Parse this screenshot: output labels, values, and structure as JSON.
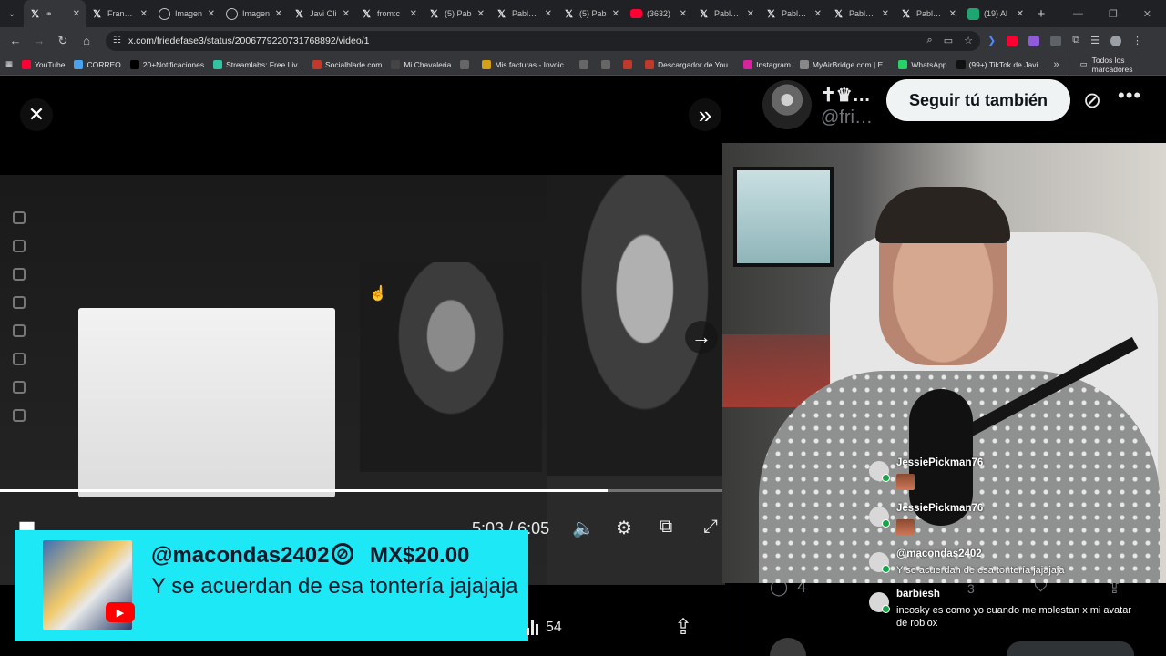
{
  "browser": {
    "tabs": [
      {
        "label": "",
        "icon": "x-icon",
        "active": true
      },
      {
        "label": "Frank C",
        "icon": "x-icon"
      },
      {
        "label": "Imagen",
        "icon": "globe-icon"
      },
      {
        "label": "Imagen",
        "icon": "globe-icon"
      },
      {
        "label": "Javi Oli",
        "icon": "x-icon"
      },
      {
        "label": "from:c",
        "icon": "x-icon"
      },
      {
        "label": "(5) Pab",
        "icon": "x-icon"
      },
      {
        "label": "Pablo X",
        "icon": "x-icon"
      },
      {
        "label": "(5) Pab",
        "icon": "x-icon"
      },
      {
        "label": "(3632)",
        "icon": "youtube-icon"
      },
      {
        "label": "Pablo X",
        "icon": "x-icon"
      },
      {
        "label": "Pablo X",
        "icon": "x-icon"
      },
      {
        "label": "Pablo X",
        "icon": "x-icon"
      },
      {
        "label": "Pablo X",
        "icon": "x-icon"
      },
      {
        "label": "(19) Al",
        "icon": "app-icon"
      }
    ],
    "url": "x.com/friedefase3/status/2006779220731768892/video/1",
    "bookmarks": [
      {
        "label": "YouTube",
        "color": "#ff0033"
      },
      {
        "label": "CORREO",
        "color": "#4aa3f0"
      },
      {
        "label": "20+Notificaciones",
        "color": "#000000"
      },
      {
        "label": "Streamlabs: Free Liv...",
        "color": "#31c3a2"
      },
      {
        "label": "Socialblade.com",
        "color": "#c0392b"
      },
      {
        "label": "Mi Chavaleria",
        "color": "#444444"
      },
      {
        "label": "",
        "color": "#666666"
      },
      {
        "label": "Mis facturas - Invoic...",
        "color": "#d4a017"
      },
      {
        "label": "",
        "color": "#666666"
      },
      {
        "label": "",
        "color": "#666666"
      },
      {
        "label": "",
        "color": "#c0392b"
      },
      {
        "label": "Descargador de You...",
        "color": "#c0392b"
      },
      {
        "label": "Instagram",
        "color": "#d6249f"
      },
      {
        "label": "MyAirBridge.com | E...",
        "color": "#888888"
      },
      {
        "label": "WhatsApp",
        "color": "#25d366"
      },
      {
        "label": "(99+) TikTok de Javi...",
        "color": "#111111"
      }
    ],
    "bookmarks_folder": "Todos los marcadores"
  },
  "video": {
    "time_current": "5:03",
    "time_total": "6:05",
    "progress": 0.838
  },
  "superchat": {
    "handle": "@macondas2402",
    "amount": "MX$20.00",
    "message": "Y se acuerdan de esa tontería jajajaja",
    "color": "#1de9f6"
  },
  "views": "54",
  "post": {
    "author_name": "✝♛…",
    "author_handle": "@fri…",
    "follow_label": "Seguir tú también",
    "reply_count": "4"
  },
  "live_chat": [
    {
      "name": "JessiePickman76",
      "text": "",
      "emote": true
    },
    {
      "name": "JessiePickman76",
      "text": "",
      "emote": true
    },
    {
      "name": "@macondas2402",
      "text": "Y se acuerdan de esa tontería jajajaja",
      "emote": false
    },
    {
      "name": "barbiesh",
      "text": "incosky es como yo cuando me molestan x mi avatar de roblox",
      "emote": false
    }
  ],
  "live_chat_extra_count": "3"
}
